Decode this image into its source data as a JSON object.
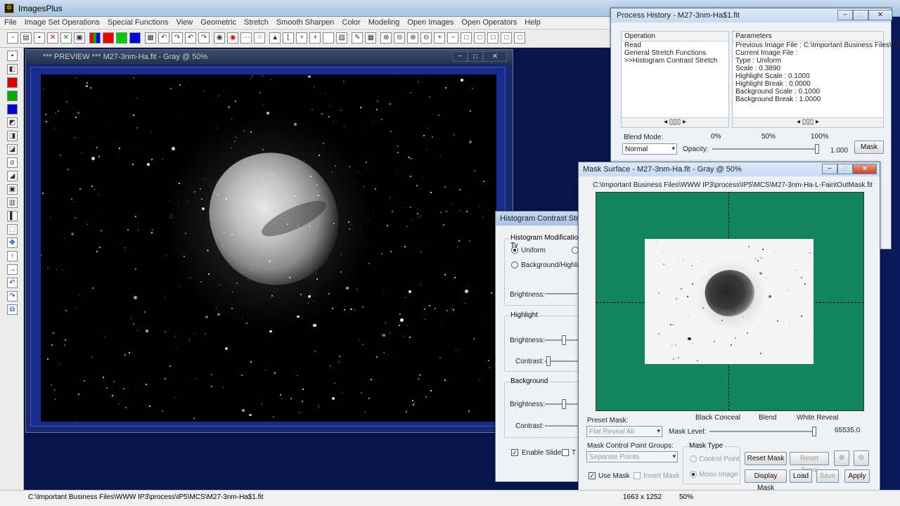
{
  "app": {
    "title": "ImagesPlus",
    "icon": "app-logo-icon"
  },
  "menu": [
    "File",
    "Image Set Operations",
    "Special Functions",
    "View",
    "Geometric",
    "Stretch",
    "Smooth Sharpen",
    "Color",
    "Modeling",
    "Open Images",
    "Open Operators",
    "Help"
  ],
  "preview": {
    "title": "*** PREVIEW *** M27-3nm-Ha.fit - Gray @ 50%"
  },
  "status": {
    "path": "C:\\Important Business Files\\WWW IP3\\process\\IP5\\MCS\\M27-3nm-Ha$1.fit",
    "dims": "1663 x 1252",
    "zoom": "50%"
  },
  "history": {
    "title": "Process History - M27-3nm-Ha$1.fit",
    "op_header": "Operation",
    "param_header": "Parameters",
    "operations": [
      "Read",
      "General Stretch Functions",
      ">>Histogram Contrast Stretch"
    ],
    "parameters": [
      "Previous Image File : C:\\Important Business Files\\WWW...",
      "Current Image File :",
      "Type : Uniform",
      "Scale : 0.3890",
      "Highlight Scale : 0.1000",
      "Highlight Break : 0.0000",
      "Background Scale : 0.1000",
      "Background Break : 1.0000"
    ],
    "blend_label": "Blend Mode:",
    "blend_value": "Normal",
    "opacity_label": "Opacity:",
    "pct0": "0%",
    "pct50": "50%",
    "pct100": "100%",
    "opacity_value": "1.000",
    "mask_button": "Mask",
    "opacity": 1.0
  },
  "hist": {
    "title": "Histogram Contrast Stretch",
    "mod_type": "Histogram Modification Ty",
    "uniform": "Uniform",
    "bg_high": "Background/Highligh",
    "brightness": "Brightness:",
    "highlight": "Highlight",
    "contrast": "Contrast:",
    "background": "Background",
    "enable_slider": "Enable Slider",
    "t_label": "T"
  },
  "mask": {
    "title": "Mask Surface - M27-3nm-Ha.fit - Gray @ 50%",
    "path": "C:\\Important Business Files\\WWW IP3\\process\\IP5\\MCS\\M27-3nm-Ha-L-FaintOutMask.fit",
    "preset_label": "Preset Mask:",
    "preset_value": "Flat Reveal All",
    "black_conceal": "Black Conceal",
    "blend": "Blend",
    "white_reveal": "White Reveal",
    "mask_level_label": "Mask Level:",
    "mask_level_value": "65535.0",
    "mcp_groups_label": "Mask Control Point Groups:",
    "mcp_groups_value": "Separate Points",
    "mask_type_label": "Mask Type",
    "control_point": "Control Point",
    "mono_image": "Mono Image",
    "use_mask": "Use Mask",
    "invert_mask": "Invert Mask",
    "reset_mask": "Reset Mask",
    "reset_zoom": "Reset Zoom",
    "display_mask": "Display Mask",
    "load": "Load",
    "save": "Save",
    "apply": "Apply",
    "bg_color": "#12855e",
    "level": 1.0
  }
}
